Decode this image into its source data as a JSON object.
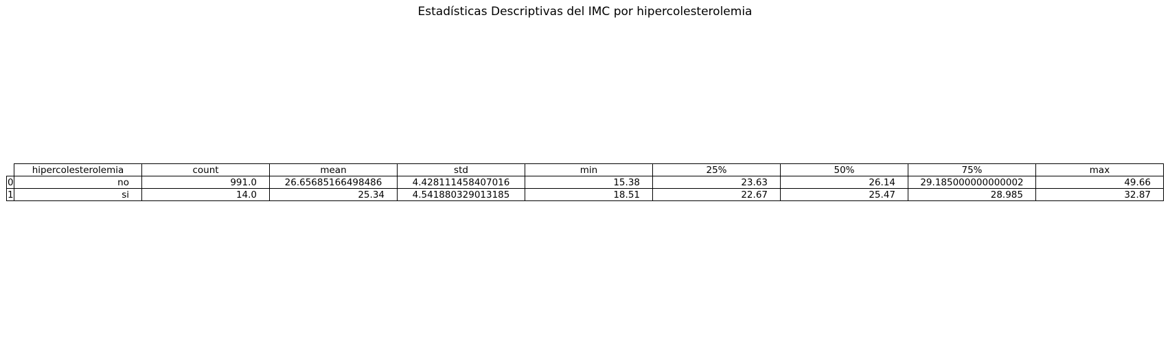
{
  "title": "Estadísticas Descriptivas del IMC por hipercolesterolemia",
  "chart_data": {
    "type": "table",
    "title": "Estadísticas Descriptivas del IMC por hipercolesterolemia",
    "columns": [
      "hipercolesterolemia",
      "count",
      "mean",
      "std",
      "min",
      "25%",
      "50%",
      "75%",
      "max"
    ],
    "rows": [
      {
        "index": "0",
        "cells": [
          "no",
          "991.0",
          "26.65685166498486",
          "4.428111458407016",
          "15.38",
          "23.63",
          "26.14",
          "29.185000000000002",
          "49.66"
        ]
      },
      {
        "index": "1",
        "cells": [
          "si",
          "14.0",
          "25.34",
          "4.541880329013185",
          "18.51",
          "22.67",
          "25.47",
          "28.985",
          "32.87"
        ]
      }
    ]
  }
}
